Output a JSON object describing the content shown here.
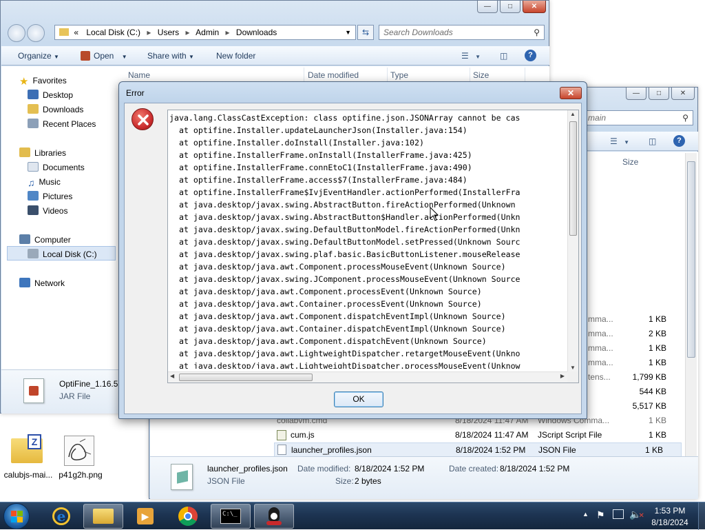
{
  "explorer": {
    "address": {
      "segments": [
        "Local Disk (C:)",
        "Users",
        "Admin",
        "Downloads"
      ],
      "prefix": "«"
    },
    "search_placeholder": "Search Downloads",
    "toolbar": {
      "organize": "Organize",
      "open": "Open",
      "share_with": "Share with",
      "new_folder": "New folder"
    },
    "columns": {
      "name": "Name",
      "date_modified": "Date modified",
      "type": "Type",
      "size": "Size"
    },
    "nav": {
      "favorites": "Favorites",
      "desktop": "Desktop",
      "downloads": "Downloads",
      "recent_places": "Recent Places",
      "libraries": "Libraries",
      "documents": "Documents",
      "music": "Music",
      "pictures": "Pictures",
      "videos": "Videos",
      "computer": "Computer",
      "local_disk": "Local Disk (C:)",
      "network": "Network"
    },
    "details": {
      "name": "OptiFine_1.16.5",
      "type": "JAR File"
    }
  },
  "explorer2": {
    "search_placeholder": "main",
    "size_header": "Size",
    "partial_rows": [
      {
        "type": "mma...",
        "size": "1 KB"
      },
      {
        "type": "mma...",
        "size": "2 KB"
      },
      {
        "type": "mma...",
        "size": "1 KB"
      },
      {
        "type": "mma...",
        "size": "1 KB"
      },
      {
        "type": "tens...",
        "size": "1,799 KB"
      },
      {
        "type": "",
        "size": "544 KB"
      },
      {
        "type": "",
        "size": "5,517 KB"
      }
    ],
    "rows": [
      {
        "name": "collabvm.cmd",
        "date": "8/18/2024 11:47 AM",
        "type": "Windows Comma...",
        "size": "1 KB"
      },
      {
        "name": "cum.js",
        "date": "8/18/2024 11:47 AM",
        "type": "JScript Script File",
        "size": "1 KB"
      },
      {
        "name": "launcher_profiles.json",
        "date": "8/18/2024 1:52 PM",
        "type": "JSON File",
        "size": "1 KB"
      }
    ],
    "details": {
      "name": "launcher_profiles.json",
      "type": "JSON File",
      "date_modified_label": "Date modified:",
      "date_modified": "8/18/2024 1:52 PM",
      "size_label": "Size:",
      "size": "2 bytes",
      "date_created_label": "Date created:",
      "date_created": "8/18/2024 1:52 PM"
    }
  },
  "dialog": {
    "title": "Error",
    "ok_label": "OK",
    "trace": [
      "java.lang.ClassCastException: class optifine.json.JSONArray cannot be cas",
      "  at optifine.Installer.updateLauncherJson(Installer.java:154)",
      "  at optifine.Installer.doInstall(Installer.java:102)",
      "  at optifine.InstallerFrame.onInstall(InstallerFrame.java:425)",
      "  at optifine.InstallerFrame.connEtoC1(InstallerFrame.java:490)",
      "  at optifine.InstallerFrame.access$7(InstallerFrame.java:484)",
      "  at optifine.InstallerFrame$IvjEventHandler.actionPerformed(InstallerFra",
      "  at java.desktop/javax.swing.AbstractButton.fireActionPerformed(Unknown ",
      "  at java.desktop/javax.swing.AbstractButton$Handler.actionPerformed(Unkn",
      "  at java.desktop/javax.swing.DefaultButtonModel.fireActionPerformed(Unkn",
      "  at java.desktop/javax.swing.DefaultButtonModel.setPressed(Unknown Sourc",
      "  at java.desktop/javax.swing.plaf.basic.BasicButtonListener.mouseRelease",
      "  at java.desktop/java.awt.Component.processMouseEvent(Unknown Source)",
      "  at java.desktop/javax.swing.JComponent.processMouseEvent(Unknown Source",
      "  at java.desktop/java.awt.Component.processEvent(Unknown Source)",
      "  at java.desktop/java.awt.Container.processEvent(Unknown Source)",
      "  at java.desktop/java.awt.Component.dispatchEventImpl(Unknown Source)",
      "  at java.desktop/java.awt.Container.dispatchEventImpl(Unknown Source)",
      "  at java.desktop/java.awt.Component.dispatchEvent(Unknown Source)",
      "  at java.desktop/java.awt.LightweightDispatcher.retargetMouseEvent(Unkno",
      "  at java.desktop/java.awt.LightweightDispatcher.processMouseEvent(Unknow"
    ]
  },
  "desktop": {
    "icons": [
      {
        "label": "calubjs-mai..."
      },
      {
        "label": "p41g2h.png"
      }
    ]
  },
  "taskbar": {
    "time": "1:53 PM",
    "date": "8/18/2024",
    "icons": [
      "start-orb",
      "internet-explorer",
      "windows-explorer",
      "media-player",
      "chrome",
      "command-prompt",
      "java"
    ]
  },
  "colors": {
    "dialog_frame": "#bfd4ea",
    "taskbar": "#1d3452",
    "error_icon": "#c8292b",
    "close_button": "#c8452c"
  }
}
